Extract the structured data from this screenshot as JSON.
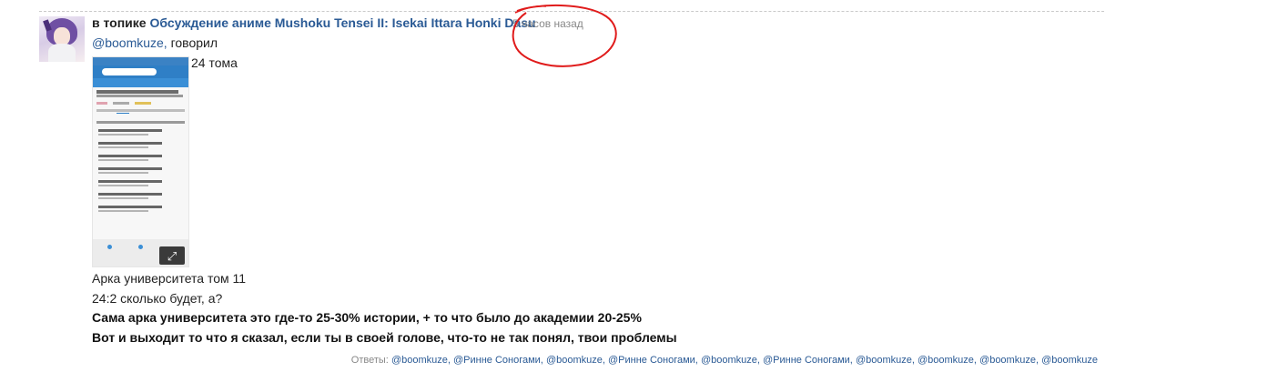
{
  "post": {
    "topic_prefix": "в топике",
    "topic_title": "Обсуждение аниме Mushoku Tensei II: Isekai Ittara Honki Dasu",
    "time_ago": "5 часов назад",
    "quote_user": "@boomkuze,",
    "quote_verb": "говорил",
    "volume_note": "24 тома",
    "lines": [
      "Арка университета том 11",
      "24:2 сколько будет, а?",
      "Сама арка университета это где-то 25-30% истории, + то что было до академии 20-25%",
      "Вот и выходит то что я сказал, если ты в своей голове, что-то не так понял, твои проблемы"
    ]
  },
  "replies": {
    "label": "Ответы:",
    "users": [
      "@boomkuze,",
      "@Ринне Соногами,",
      "@boomkuze,",
      "@Ринне Соногами,",
      "@boomkuze,",
      "@Ринне Соногами,",
      "@boomkuze,",
      "@boomkuze,",
      "@boomkuze,",
      "@boomkuze"
    ]
  },
  "icons": {
    "expand": "expand-icon",
    "annotation": "red-circle-annotation"
  },
  "colors": {
    "link": "#2a5a95",
    "annotation": "#e01b1b",
    "screenshot_header": "#2f7fc6"
  }
}
